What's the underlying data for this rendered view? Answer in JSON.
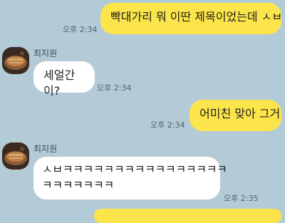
{
  "messages": [
    {
      "type": "outgoing",
      "text": "빡대가리 뭐 이딴 제목이었는데 ㅅㅂ",
      "time": "오후 2:34"
    },
    {
      "type": "incoming",
      "sender": "최지원",
      "text": "세얼간이?",
      "time": "오후 2:34",
      "avatar_icon": "food-photo-avatar"
    },
    {
      "type": "outgoing",
      "text": "어미친 맞아 그거",
      "time": "오후 2:34"
    },
    {
      "type": "incoming",
      "sender": "최지원",
      "text_line1": "ㅅㅂㅋㅋㅋㅋㅋㅋㅋㅋㅋㅋㅋㅋㅋㅋㅋㅋ",
      "text_line2": "ㅋㅋㅋㅋㅋㅋㅋ",
      "time": "오후 2:35",
      "avatar_icon": "food-photo-avatar"
    }
  ],
  "colors": {
    "background": "#b3cbd7",
    "outgoing_bubble": "#fce54a",
    "incoming_bubble": "#ffffff"
  }
}
